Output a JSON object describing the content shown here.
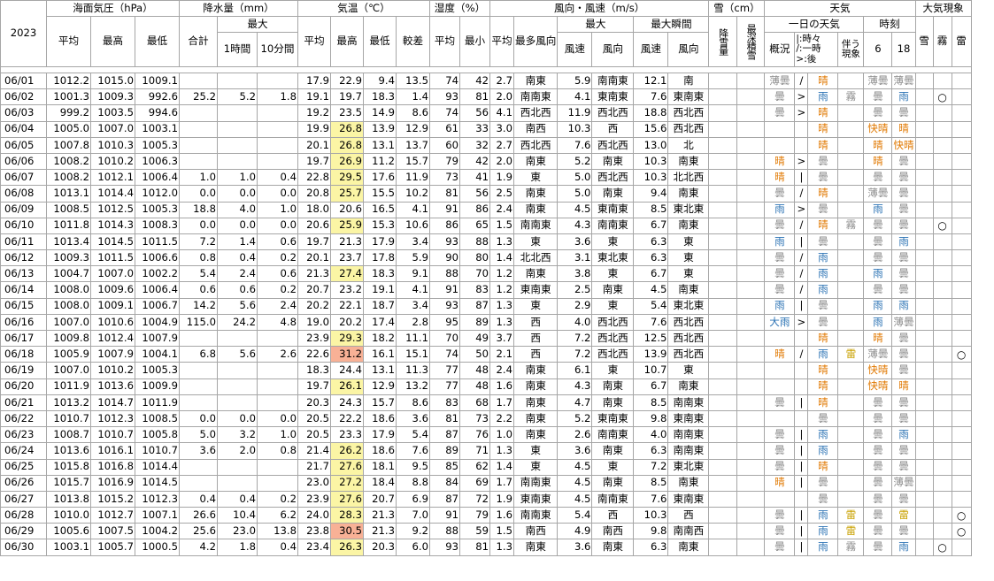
{
  "year": "2023",
  "headers": {
    "pressure": "海面気圧（hPa）",
    "precip": "降水量（mm）",
    "temp": "気温（℃）",
    "humidity": "湿度（%）",
    "wind": "風向・風速（m/s）",
    "snow": "雪（cm）",
    "weather": "天気",
    "phenom": "大気現象",
    "max": "最大",
    "max_gust": "最大瞬間",
    "weather_day": "一日の天気",
    "time": "時刻",
    "avg": "平均",
    "high": "最高",
    "low": "最低",
    "total": "合計",
    "h1": "1時間",
    "m10": "10分間",
    "range": "較差",
    "min": "最小",
    "most_dir": "最多風向",
    "speed": "風速",
    "dir": "風向",
    "snowfall": "降雪量",
    "snowdepth": "最深積雪",
    "overview": "概況",
    "legend": "|:時々\n/:一時\n>:後",
    "accomp": "伴う現象",
    "t6": "6",
    "t18": "18",
    "p_snow": "雪",
    "p_fog": "霧",
    "p_thunder": "雷"
  },
  "rows": [
    [
      "06/01",
      "1012.2",
      "1015.0",
      "1009.1",
      "",
      "",
      "",
      "17.9",
      "22.9",
      "9.4",
      "13.5",
      "74",
      "42",
      "2.7",
      "南東",
      "5.9",
      "南南東",
      "12.1",
      "南",
      "",
      "",
      "薄曇",
      "/",
      "晴",
      "",
      "薄曇",
      "薄曇",
      "",
      "",
      ""
    ],
    [
      "06/02",
      "1001.3",
      "1009.3",
      "992.6",
      "25.2",
      "5.2",
      "1.8",
      "19.1",
      "19.7",
      "18.3",
      "1.4",
      "93",
      "81",
      "2.0",
      "南南東",
      "4.1",
      "東南東",
      "7.6",
      "東南東",
      "",
      "",
      "曇",
      ">",
      "雨",
      "霧",
      "曇",
      "雨",
      "",
      "○",
      ""
    ],
    [
      "06/03",
      "999.2",
      "1003.5",
      "994.6",
      "",
      "",
      "",
      "19.2",
      "23.5",
      "14.9",
      "8.6",
      "74",
      "56",
      "4.1",
      "西北西",
      "11.9",
      "西北西",
      "18.8",
      "西北西",
      "",
      "",
      "曇",
      ">",
      "晴",
      "",
      "曇",
      "曇",
      "",
      "",
      ""
    ],
    [
      "06/04",
      "1005.0",
      "1007.0",
      "1003.1",
      "",
      "",
      "",
      "19.9",
      "26.8",
      "13.9",
      "12.9",
      "61",
      "33",
      "3.0",
      "南西",
      "10.3",
      "西",
      "15.6",
      "西北西",
      "",
      "",
      "",
      "",
      "晴",
      "",
      "快晴",
      "晴",
      "",
      "",
      ""
    ],
    [
      "06/05",
      "1007.8",
      "1010.3",
      "1005.3",
      "",
      "",
      "",
      "20.1",
      "26.8",
      "13.1",
      "13.7",
      "60",
      "32",
      "2.7",
      "西北西",
      "7.6",
      "西北西",
      "13.0",
      "北",
      "",
      "",
      "",
      "",
      "晴",
      "",
      "晴",
      "快晴",
      "",
      "",
      ""
    ],
    [
      "06/06",
      "1008.2",
      "1010.2",
      "1006.3",
      "",
      "",
      "",
      "19.7",
      "26.9",
      "11.2",
      "15.7",
      "79",
      "42",
      "2.0",
      "南東",
      "5.2",
      "南東",
      "10.3",
      "南東",
      "",
      "",
      "晴",
      ">",
      "曇",
      "",
      "晴",
      "曇",
      "",
      "",
      ""
    ],
    [
      "06/07",
      "1008.2",
      "1012.1",
      "1006.4",
      "1.0",
      "1.0",
      "0.4",
      "22.8",
      "29.5",
      "17.6",
      "11.9",
      "73",
      "41",
      "1.9",
      "東",
      "5.0",
      "西北西",
      "10.3",
      "北北西",
      "",
      "",
      "晴",
      "|",
      "曇",
      "",
      "曇",
      "曇",
      "",
      "",
      ""
    ],
    [
      "06/08",
      "1013.1",
      "1014.4",
      "1012.0",
      "0.0",
      "0.0",
      "0.0",
      "20.8",
      "25.7",
      "15.5",
      "10.2",
      "81",
      "56",
      "2.5",
      "南東",
      "5.0",
      "南東",
      "9.4",
      "南東",
      "",
      "",
      "曇",
      "/",
      "晴",
      "",
      "薄曇",
      "曇",
      "",
      "",
      ""
    ],
    [
      "06/09",
      "1008.5",
      "1012.5",
      "1005.3",
      "18.8",
      "4.0",
      "1.0",
      "18.0",
      "20.6",
      "16.5",
      "4.1",
      "91",
      "86",
      "2.4",
      "南東",
      "4.5",
      "東南東",
      "8.5",
      "東北東",
      "",
      "",
      "雨",
      ">",
      "曇",
      "",
      "雨",
      "曇",
      "",
      "",
      ""
    ],
    [
      "06/10",
      "1011.8",
      "1014.3",
      "1008.3",
      "0.0",
      "0.0",
      "0.0",
      "20.6",
      "25.9",
      "15.3",
      "10.6",
      "86",
      "65",
      "1.5",
      "南南東",
      "4.3",
      "南南東",
      "6.7",
      "南東",
      "",
      "",
      "曇",
      "/",
      "晴",
      "霧",
      "曇",
      "曇",
      "",
      "○",
      ""
    ],
    [
      "06/11",
      "1013.4",
      "1014.5",
      "1011.5",
      "7.2",
      "1.4",
      "0.6",
      "19.7",
      "21.3",
      "17.9",
      "3.4",
      "93",
      "88",
      "1.3",
      "東",
      "3.6",
      "東",
      "6.3",
      "東",
      "",
      "",
      "雨",
      "|",
      "曇",
      "",
      "曇",
      "雨",
      "",
      "",
      ""
    ],
    [
      "06/12",
      "1009.3",
      "1011.5",
      "1006.6",
      "0.8",
      "0.4",
      "0.2",
      "20.1",
      "23.7",
      "17.8",
      "5.9",
      "90",
      "80",
      "1.4",
      "北北西",
      "3.1",
      "東北東",
      "6.3",
      "東",
      "",
      "",
      "曇",
      "/",
      "雨",
      "",
      "曇",
      "曇",
      "",
      "",
      ""
    ],
    [
      "06/13",
      "1004.7",
      "1007.0",
      "1002.2",
      "5.4",
      "2.4",
      "0.6",
      "21.3",
      "27.4",
      "18.3",
      "9.1",
      "88",
      "70",
      "1.2",
      "南東",
      "3.8",
      "東",
      "6.7",
      "東",
      "",
      "",
      "曇",
      "/",
      "雨",
      "",
      "雨",
      "曇",
      "",
      "",
      ""
    ],
    [
      "06/14",
      "1008.0",
      "1009.6",
      "1006.4",
      "0.6",
      "0.6",
      "0.2",
      "20.7",
      "23.2",
      "19.1",
      "4.1",
      "91",
      "83",
      "1.2",
      "東南東",
      "2.5",
      "南東",
      "4.5",
      "南東",
      "",
      "",
      "曇",
      "/",
      "雨",
      "",
      "曇",
      "曇",
      "",
      "",
      ""
    ],
    [
      "06/15",
      "1008.0",
      "1009.1",
      "1006.7",
      "14.2",
      "5.6",
      "2.4",
      "20.2",
      "22.1",
      "18.7",
      "3.4",
      "93",
      "87",
      "1.3",
      "東",
      "2.9",
      "東",
      "5.4",
      "東北東",
      "",
      "",
      "雨",
      "|",
      "曇",
      "",
      "雨",
      "雨",
      "",
      "",
      ""
    ],
    [
      "06/16",
      "1007.0",
      "1010.6",
      "1004.9",
      "115.0",
      "24.2",
      "4.8",
      "19.0",
      "20.2",
      "17.4",
      "2.8",
      "95",
      "89",
      "1.3",
      "西",
      "4.0",
      "西北西",
      "7.6",
      "西北西",
      "",
      "",
      "大雨",
      ">",
      "曇",
      "",
      "雨",
      "薄曇",
      "",
      "",
      ""
    ],
    [
      "06/17",
      "1009.8",
      "1012.4",
      "1007.9",
      "",
      "",
      "",
      "23.9",
      "29.3",
      "18.2",
      "11.1",
      "70",
      "49",
      "3.7",
      "西",
      "7.2",
      "西北西",
      "12.5",
      "西北西",
      "",
      "",
      "",
      "",
      "晴",
      "",
      "晴",
      "曇",
      "",
      "",
      ""
    ],
    [
      "06/18",
      "1005.9",
      "1007.9",
      "1004.1",
      "6.8",
      "5.6",
      "2.6",
      "22.6",
      "31.2",
      "16.1",
      "15.1",
      "74",
      "50",
      "2.1",
      "西",
      "7.2",
      "西北西",
      "13.9",
      "西北西",
      "",
      "",
      "晴",
      "/",
      "雨",
      "雷",
      "薄曇",
      "曇",
      "",
      "",
      "○"
    ],
    [
      "06/19",
      "1007.0",
      "1010.2",
      "1005.3",
      "",
      "",
      "",
      "18.3",
      "24.4",
      "13.1",
      "11.3",
      "77",
      "48",
      "2.4",
      "南東",
      "6.1",
      "東",
      "10.7",
      "東",
      "",
      "",
      "",
      "",
      "晴",
      "",
      "快晴",
      "曇",
      "",
      "",
      ""
    ],
    [
      "06/20",
      "1011.9",
      "1013.6",
      "1009.9",
      "",
      "",
      "",
      "19.7",
      "26.1",
      "12.9",
      "13.2",
      "77",
      "48",
      "1.6",
      "南東",
      "4.3",
      "南東",
      "6.7",
      "南東",
      "",
      "",
      "",
      "",
      "晴",
      "",
      "快晴",
      "晴",
      "",
      "",
      ""
    ],
    [
      "06/21",
      "1013.2",
      "1014.7",
      "1011.9",
      "",
      "",
      "",
      "20.3",
      "24.3",
      "15.7",
      "8.6",
      "83",
      "68",
      "1.7",
      "南東",
      "4.7",
      "南東",
      "8.5",
      "南南東",
      "",
      "",
      "曇",
      "|",
      "晴",
      "",
      "曇",
      "曇",
      "",
      "",
      ""
    ],
    [
      "06/22",
      "1010.7",
      "1012.3",
      "1008.5",
      "0.0",
      "0.0",
      "0.0",
      "20.5",
      "22.2",
      "18.6",
      "3.6",
      "81",
      "73",
      "2.2",
      "南東",
      "5.2",
      "東南東",
      "9.8",
      "東南東",
      "",
      "",
      "",
      "",
      "曇",
      "",
      "曇",
      "曇",
      "",
      "",
      ""
    ],
    [
      "06/23",
      "1008.7",
      "1010.7",
      "1005.8",
      "5.0",
      "3.2",
      "1.0",
      "20.5",
      "23.3",
      "17.9",
      "5.4",
      "87",
      "76",
      "1.0",
      "南東",
      "2.6",
      "南南東",
      "4.0",
      "南南東",
      "",
      "",
      "曇",
      "|",
      "雨",
      "",
      "曇",
      "雨",
      "",
      "",
      ""
    ],
    [
      "06/24",
      "1013.6",
      "1016.1",
      "1010.7",
      "3.6",
      "2.0",
      "0.8",
      "21.4",
      "26.2",
      "18.6",
      "7.6",
      "89",
      "71",
      "1.3",
      "東",
      "3.6",
      "南東",
      "6.3",
      "南南東",
      "",
      "",
      "曇",
      "|",
      "雨",
      "",
      "曇",
      "曇",
      "",
      "",
      ""
    ],
    [
      "06/25",
      "1015.8",
      "1016.8",
      "1014.4",
      "",
      "",
      "",
      "21.7",
      "27.6",
      "18.1",
      "9.5",
      "85",
      "62",
      "1.4",
      "東",
      "4.5",
      "東",
      "7.2",
      "東北東",
      "",
      "",
      "曇",
      "|",
      "晴",
      "",
      "曇",
      "曇",
      "",
      "",
      ""
    ],
    [
      "06/26",
      "1015.7",
      "1016.9",
      "1014.5",
      "",
      "",
      "",
      "23.0",
      "27.2",
      "18.4",
      "8.8",
      "84",
      "69",
      "1.7",
      "南南東",
      "4.5",
      "南東",
      "8.5",
      "南東",
      "",
      "",
      "晴",
      "|",
      "曇",
      "",
      "曇",
      "薄曇",
      "",
      "",
      ""
    ],
    [
      "06/27",
      "1013.8",
      "1015.2",
      "1012.3",
      "0.4",
      "0.4",
      "0.2",
      "23.9",
      "27.6",
      "20.7",
      "6.9",
      "87",
      "72",
      "1.9",
      "東南東",
      "4.5",
      "南南東",
      "7.6",
      "東南東",
      "",
      "",
      "",
      "",
      "曇",
      "",
      "曇",
      "曇",
      "",
      "",
      ""
    ],
    [
      "06/28",
      "1010.0",
      "1012.7",
      "1007.1",
      "26.6",
      "10.4",
      "6.2",
      "24.0",
      "28.3",
      "21.3",
      "7.0",
      "91",
      "79",
      "1.6",
      "南南東",
      "5.4",
      "西",
      "10.3",
      "西",
      "",
      "",
      "曇",
      "|",
      "雨",
      "雷",
      "曇",
      "雷",
      "",
      "",
      "○"
    ],
    [
      "06/29",
      "1005.6",
      "1007.5",
      "1004.2",
      "25.6",
      "23.0",
      "13.8",
      "23.8",
      "30.5",
      "21.3",
      "9.2",
      "88",
      "59",
      "1.5",
      "南西",
      "4.9",
      "南西",
      "9.8",
      "南南西",
      "",
      "",
      "曇",
      "|",
      "雨",
      "雷",
      "曇",
      "曇",
      "",
      "",
      "○"
    ],
    [
      "06/30",
      "1003.1",
      "1005.7",
      "1000.5",
      "4.2",
      "1.8",
      "0.4",
      "23.4",
      "26.3",
      "20.3",
      "6.0",
      "93",
      "81",
      "1.3",
      "南東",
      "3.6",
      "南東",
      "6.3",
      "南東",
      "",
      "",
      "曇",
      "|",
      "雨",
      "霧",
      "曇",
      "雨",
      "",
      "○",
      ""
    ]
  ],
  "colors": {
    "hot": "#fbf5a5",
    "very_hot": "#f8b196",
    "sun": "#e07800",
    "cloud": "#8c8c8c",
    "rain": "#2e74b5",
    "thunder": "#c9a100",
    "grid": "#a6a6a6"
  }
}
